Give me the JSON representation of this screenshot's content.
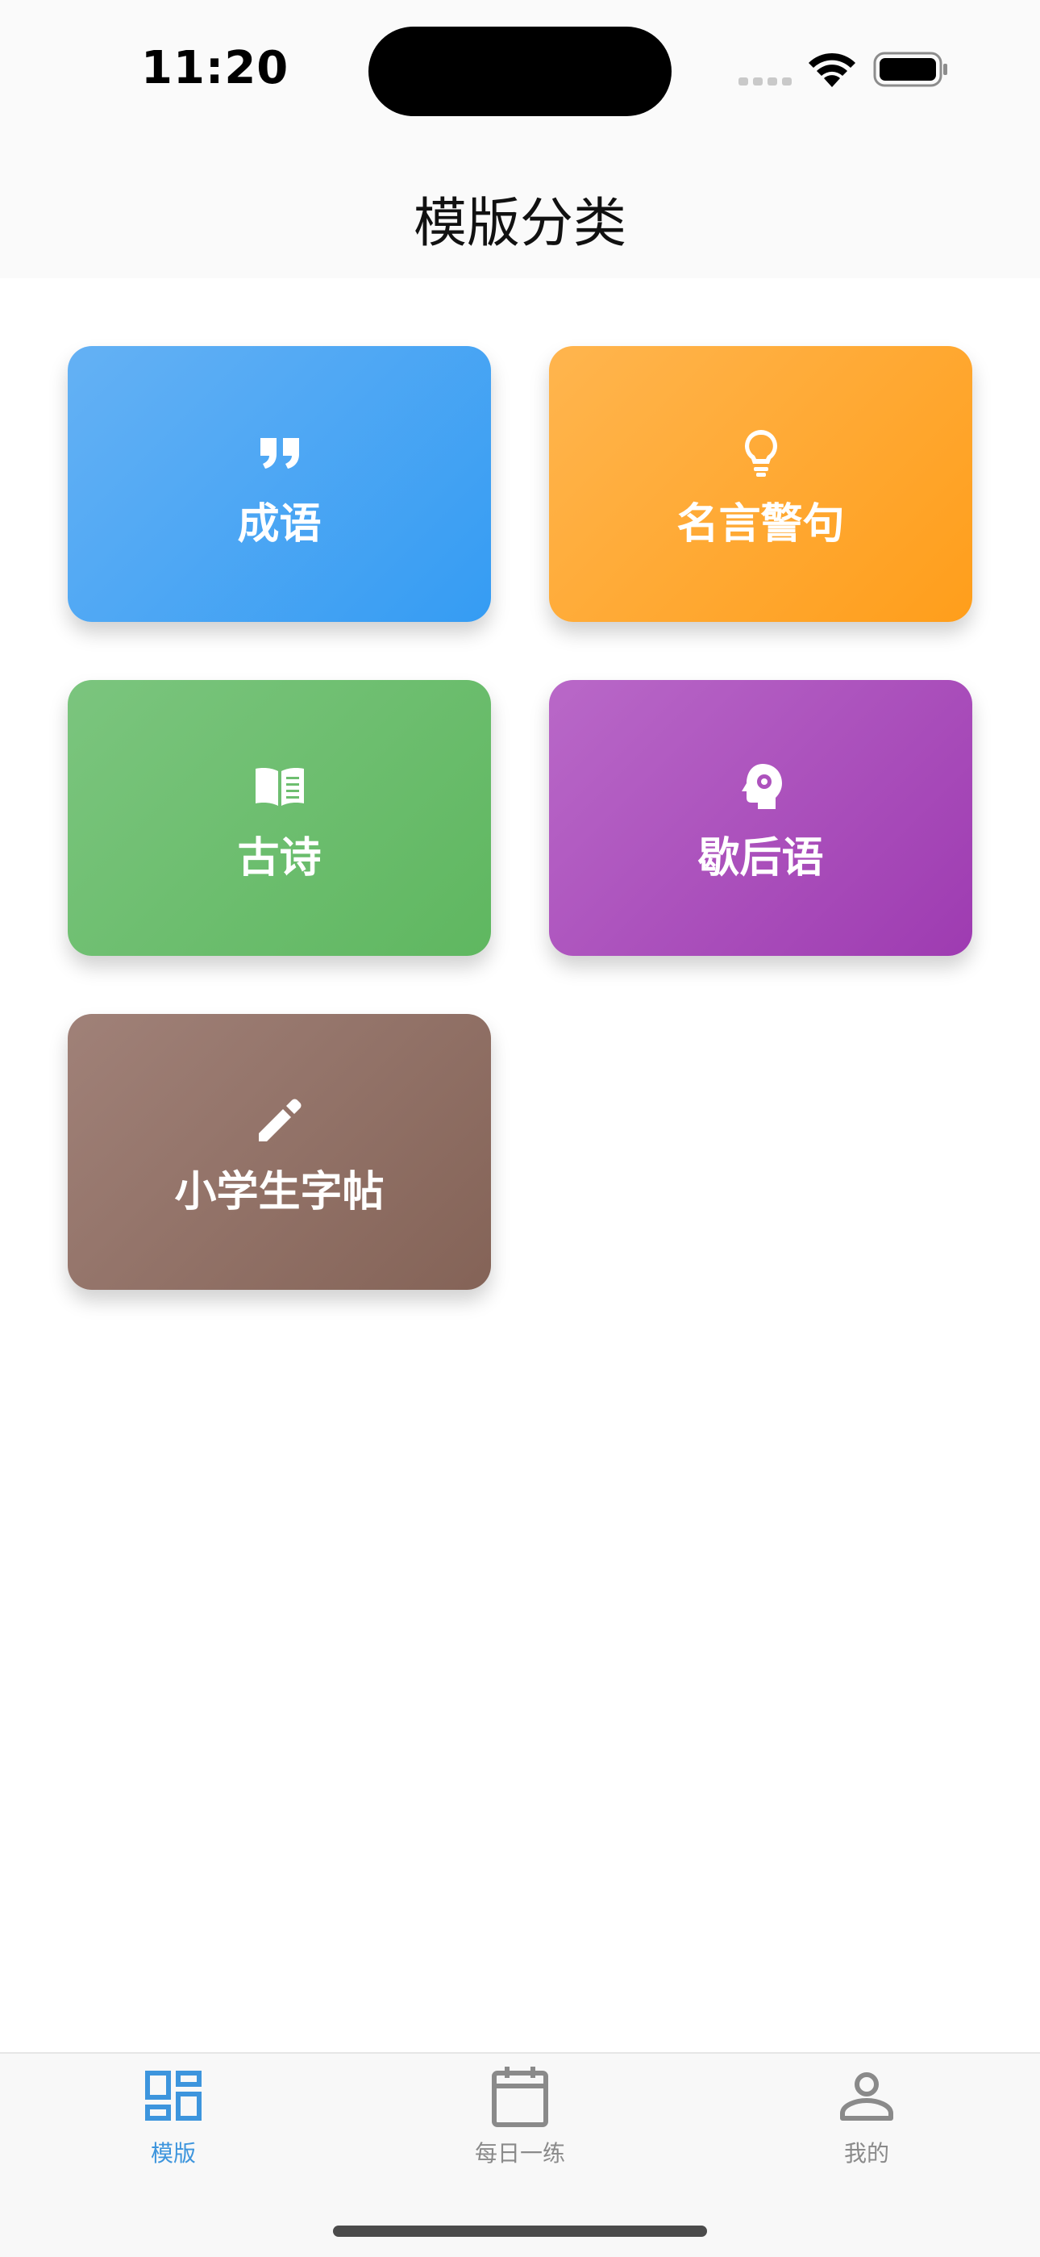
{
  "status_bar": {
    "time": "11:20"
  },
  "nav": {
    "title": "模版分类"
  },
  "categories": [
    {
      "label": "成语",
      "icon": "quote-icon",
      "color": "#4aa5f3"
    },
    {
      "label": "名言警句",
      "icon": "lightbulb-icon",
      "color": "#ffa935"
    },
    {
      "label": "古诗",
      "icon": "book-icon",
      "color": "#6dbe6f"
    },
    {
      "label": "歇后语",
      "icon": "head-gear-icon",
      "color": "#ad52bd"
    },
    {
      "label": "小学生字帖",
      "icon": "pencil-icon",
      "color": "#927268"
    }
  ],
  "tab_bar": {
    "active_color": "#3d95dd",
    "inactive_color": "#8a8a8a",
    "tabs": [
      {
        "label": "模版",
        "icon": "dashboard-icon",
        "active": true
      },
      {
        "label": "每日一练",
        "icon": "calendar-icon",
        "active": false
      },
      {
        "label": "我的",
        "icon": "person-icon",
        "active": false
      }
    ]
  }
}
